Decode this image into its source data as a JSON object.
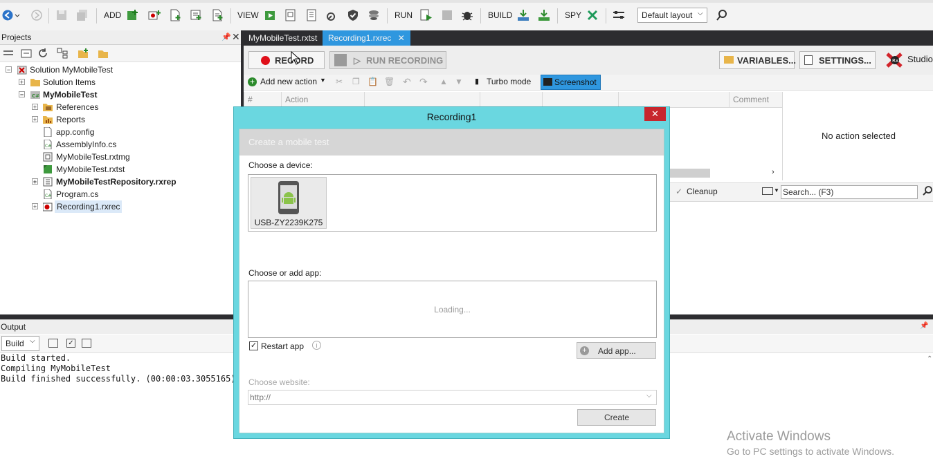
{
  "toolbar": {
    "add": "ADD",
    "view": "VIEW",
    "run": "RUN",
    "build": "BUILD",
    "spy": "SPY",
    "layout_value": "Default layout"
  },
  "projects": {
    "title": "Projects",
    "tree": [
      {
        "label": "Solution MyMobileTest",
        "icon": "solution-icon",
        "bold": false
      },
      {
        "label": "Solution Items",
        "icon": "folder-icon",
        "bold": false
      },
      {
        "label": "MyMobileTest",
        "icon": "project-icon",
        "bold": true
      },
      {
        "label": "References",
        "icon": "references-icon",
        "bold": false
      },
      {
        "label": "Reports",
        "icon": "reports-icon",
        "bold": false
      },
      {
        "label": "app.config",
        "icon": "config-file-icon",
        "bold": false
      },
      {
        "label": "AssemblyInfo.cs",
        "icon": "cs-file-icon",
        "bold": false
      },
      {
        "label": "MyMobileTest.rxtmg",
        "icon": "rxtmg-file-icon",
        "bold": false
      },
      {
        "label": "MyMobileTest.rxtst",
        "icon": "rxtst-file-icon",
        "bold": false
      },
      {
        "label": "MyMobileTestRepository.rxrep",
        "icon": "repository-icon",
        "bold": true
      },
      {
        "label": "Program.cs",
        "icon": "cs-file-icon",
        "bold": false
      },
      {
        "label": "Recording1.rxrec",
        "icon": "recording-icon",
        "bold": false
      }
    ]
  },
  "tabs": {
    "tab1": "MyMobileTest.rxtst",
    "tab2": "Recording1.rxrec"
  },
  "recorder": {
    "record": "RECORD",
    "run_recording": "RUN RECORDING",
    "variables": "VARIABLES...",
    "settings": "SETTINGS...",
    "studio": "Studio",
    "add_new_action": "Add new action",
    "turbo_mode": "Turbo mode",
    "screenshot": "Screenshot",
    "col_hash": "#",
    "col_action": "Action",
    "col_comment": "Comment",
    "no_action": "No action selected",
    "cleanup": "Cleanup",
    "search_placeholder": "Search... (F3)"
  },
  "output": {
    "title": "Output",
    "filter_value": "Build",
    "lines": "Build started.\nCompiling MyMobileTest\nBuild finished successfully. (00:00:03.3055165)"
  },
  "dialog": {
    "title": "Recording1",
    "banner": "Create a mobile test",
    "choose_device": "Choose a device:",
    "device_name": "USB-ZY2239K275",
    "choose_app": "Choose or add app:",
    "loading": "Loading...",
    "restart_app": "Restart app",
    "add_app": "Add app...",
    "choose_website": "Choose website:",
    "website_value": "http://",
    "create": "Create"
  },
  "watermark": {
    "line1": "Activate Windows",
    "line2": "Go to PC settings to activate Windows."
  }
}
